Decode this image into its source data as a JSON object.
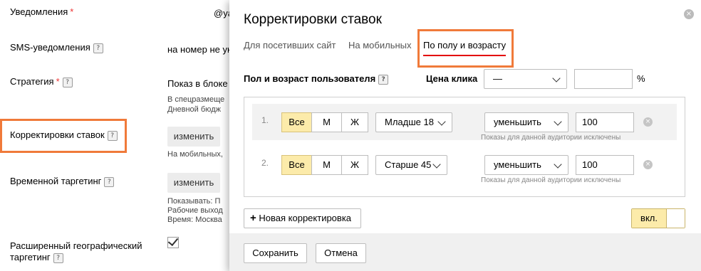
{
  "form": {
    "notifications_label": "Уведомления",
    "notifications_required": "*",
    "notifications_value": "@ya",
    "sms_label": "SMS-уведомления",
    "sms_value": "на номер не ук",
    "strategy_label": "Стратегия",
    "strategy_required": "*",
    "strategy_value": "Показ в блоке",
    "strategy_note1": "В спецразмеще",
    "strategy_note2": "Дневной бюдж",
    "bid_adjust_label": "Корректировки ставок",
    "bid_adjust_button": "изменить",
    "bid_adjust_note": "На мобильных,",
    "time_target_label": "Временной таргетинг",
    "time_target_button": "изменить",
    "time_note1": "Показывать: П",
    "time_note2": "Рабочие выход",
    "time_note3": "Время: Москва",
    "geo_label_line1": "Расширенный географический",
    "geo_label_line2": "таргетинг",
    "help_glyph": "?"
  },
  "modal": {
    "title": "Корректировки ставок",
    "close_glyph": "×",
    "tabs": [
      "Для посетивших сайт",
      "На мобильных",
      "По полу и возрасту"
    ],
    "active_tab": 2,
    "header_label": "Пол и возраст пользователя",
    "click_price_label": "Цена клика",
    "click_price_select": "—",
    "click_price_value": "",
    "percent_sign": "%",
    "rows": [
      {
        "num": "1.",
        "gender": [
          "Все",
          "М",
          "Ж"
        ],
        "gender_selected": 0,
        "age": "Младше 18",
        "action": "уменьшить",
        "value": "100",
        "hint": "Показы для данной аудитории исключены"
      },
      {
        "num": "2.",
        "gender": [
          "Все",
          "М",
          "Ж"
        ],
        "gender_selected": 0,
        "age": "Старше 45",
        "action": "уменьшить",
        "value": "100",
        "hint": "Показы для данной аудитории исключены"
      }
    ],
    "new_adjust_plus": "+",
    "new_adjust_label": "Новая корректировка",
    "toggle_label": "вкл.",
    "toggle_on": true,
    "save_label": "Сохранить",
    "cancel_label": "Отмена"
  },
  "colors": {
    "highlight": "#f07a3a",
    "tab_underline": "#e30000",
    "segment_selected": "#fcebaa",
    "required": "#e33333"
  }
}
